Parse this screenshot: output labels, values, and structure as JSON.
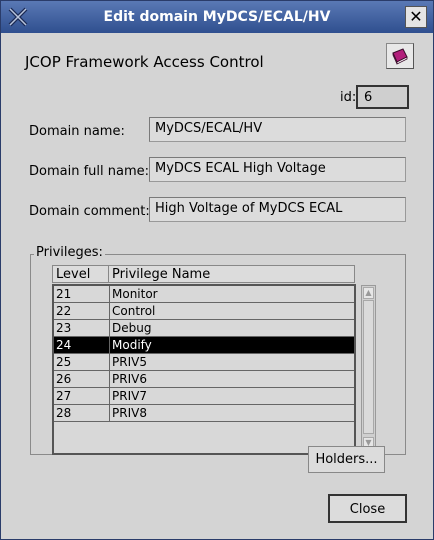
{
  "window": {
    "title": "Edit domain MyDCS/ECAL/HV",
    "close_glyph": "✕"
  },
  "app_title": "JCOP Framework Access Control",
  "id": {
    "label": "id:",
    "value": "6"
  },
  "fields": {
    "domain_name": {
      "label": "Domain name:",
      "value": "MyDCS/ECAL/HV"
    },
    "domain_full_name": {
      "label": "Domain full name:",
      "value": "MyDCS ECAL High Voltage"
    },
    "domain_comment": {
      "label": "Domain comment:",
      "value": "High Voltage of MyDCS ECAL"
    }
  },
  "privileges": {
    "group_label": "Privileges:",
    "columns": [
      "Level",
      "Privilege Name"
    ],
    "rows": [
      {
        "level": "21",
        "name": "Monitor"
      },
      {
        "level": "22",
        "name": "Control"
      },
      {
        "level": "23",
        "name": "Debug"
      },
      {
        "level": "24",
        "name": "Modify"
      },
      {
        "level": "25",
        "name": "PRIV5"
      },
      {
        "level": "26",
        "name": "PRIV6"
      },
      {
        "level": "27",
        "name": "PRIV7"
      },
      {
        "level": "28",
        "name": "PRIV8"
      }
    ],
    "selected_index": 3
  },
  "buttons": {
    "holders": "Holders...",
    "close": "Close"
  },
  "icons": {
    "window_logo": "x-logo-icon",
    "help": "book-icon",
    "close": "close-icon"
  }
}
